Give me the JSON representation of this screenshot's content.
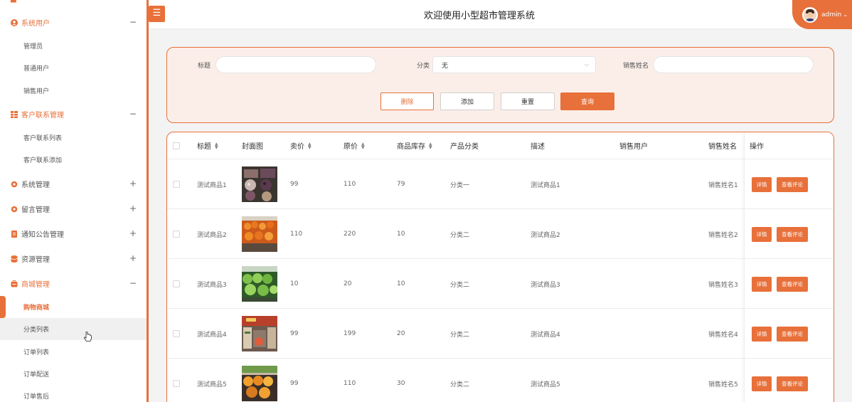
{
  "sidebar": {
    "groups": [
      {
        "label": "系统用户",
        "icon": "user-circle-icon",
        "toggle": "−"
      },
      {
        "label": "客户联系管理",
        "icon": "grid-icon",
        "toggle": "−"
      },
      {
        "label": "系统管理",
        "icon": "gear-icon",
        "toggle": "+"
      },
      {
        "label": "留言管理",
        "icon": "gear-icon",
        "toggle": "+"
      },
      {
        "label": "通知公告管理",
        "icon": "document-icon",
        "toggle": "+"
      },
      {
        "label": "资源管理",
        "icon": "database-icon",
        "toggle": "+"
      },
      {
        "label": "商城管理",
        "icon": "shop-icon",
        "toggle": "−"
      }
    ],
    "sub_user": [
      "管理员",
      "普通用户",
      "销售用户"
    ],
    "sub_contact": [
      "客户联系列表",
      "客户联系添加"
    ],
    "sub_shop": [
      "购物商城",
      "分类列表",
      "订单列表",
      "订单配送",
      "订单售后"
    ]
  },
  "header": {
    "title": "欢迎使用小型超市管理系统",
    "menu_icon": "☰",
    "user": "admin",
    "user_caret": "⌄"
  },
  "search": {
    "title_label": "标题",
    "title_value": "",
    "category_label": "分类",
    "category_value": "无",
    "seller_label": "销售姓名",
    "seller_value": "",
    "delete": "删除",
    "add": "添加",
    "reset": "重置",
    "query": "查询"
  },
  "table": {
    "headers": [
      "标题",
      "封面图",
      "卖价",
      "原价",
      "商品库存",
      "产品分类",
      "描述",
      "销售用户",
      "销售姓名",
      "操作"
    ],
    "rows": [
      {
        "title": "测试商品1",
        "price": "99",
        "original": "110",
        "stock": "79",
        "category": "分类一",
        "desc": "测试商品1",
        "user": "",
        "seller": "销售姓名1"
      },
      {
        "title": "测试商品2",
        "price": "110",
        "original": "220",
        "stock": "10",
        "category": "分类二",
        "desc": "测试商品2",
        "user": "",
        "seller": "销售姓名2"
      },
      {
        "title": "测试商品3",
        "price": "10",
        "original": "20",
        "stock": "10",
        "category": "分类二",
        "desc": "测试商品3",
        "user": "",
        "seller": "销售姓名3"
      },
      {
        "title": "测试商品4",
        "price": "99",
        "original": "199",
        "stock": "20",
        "category": "分类二",
        "desc": "测试商品4",
        "user": "",
        "seller": "销售姓名4"
      },
      {
        "title": "测试商品5",
        "price": "99",
        "original": "110",
        "stock": "30",
        "category": "分类二",
        "desc": "测试商品5",
        "user": "",
        "seller": "销售姓名5"
      }
    ],
    "detail_btn": "详情",
    "comment_btn": "查看评论"
  },
  "colors": {
    "accent": "#e8703a",
    "panel_bg": "#fbeee8"
  }
}
